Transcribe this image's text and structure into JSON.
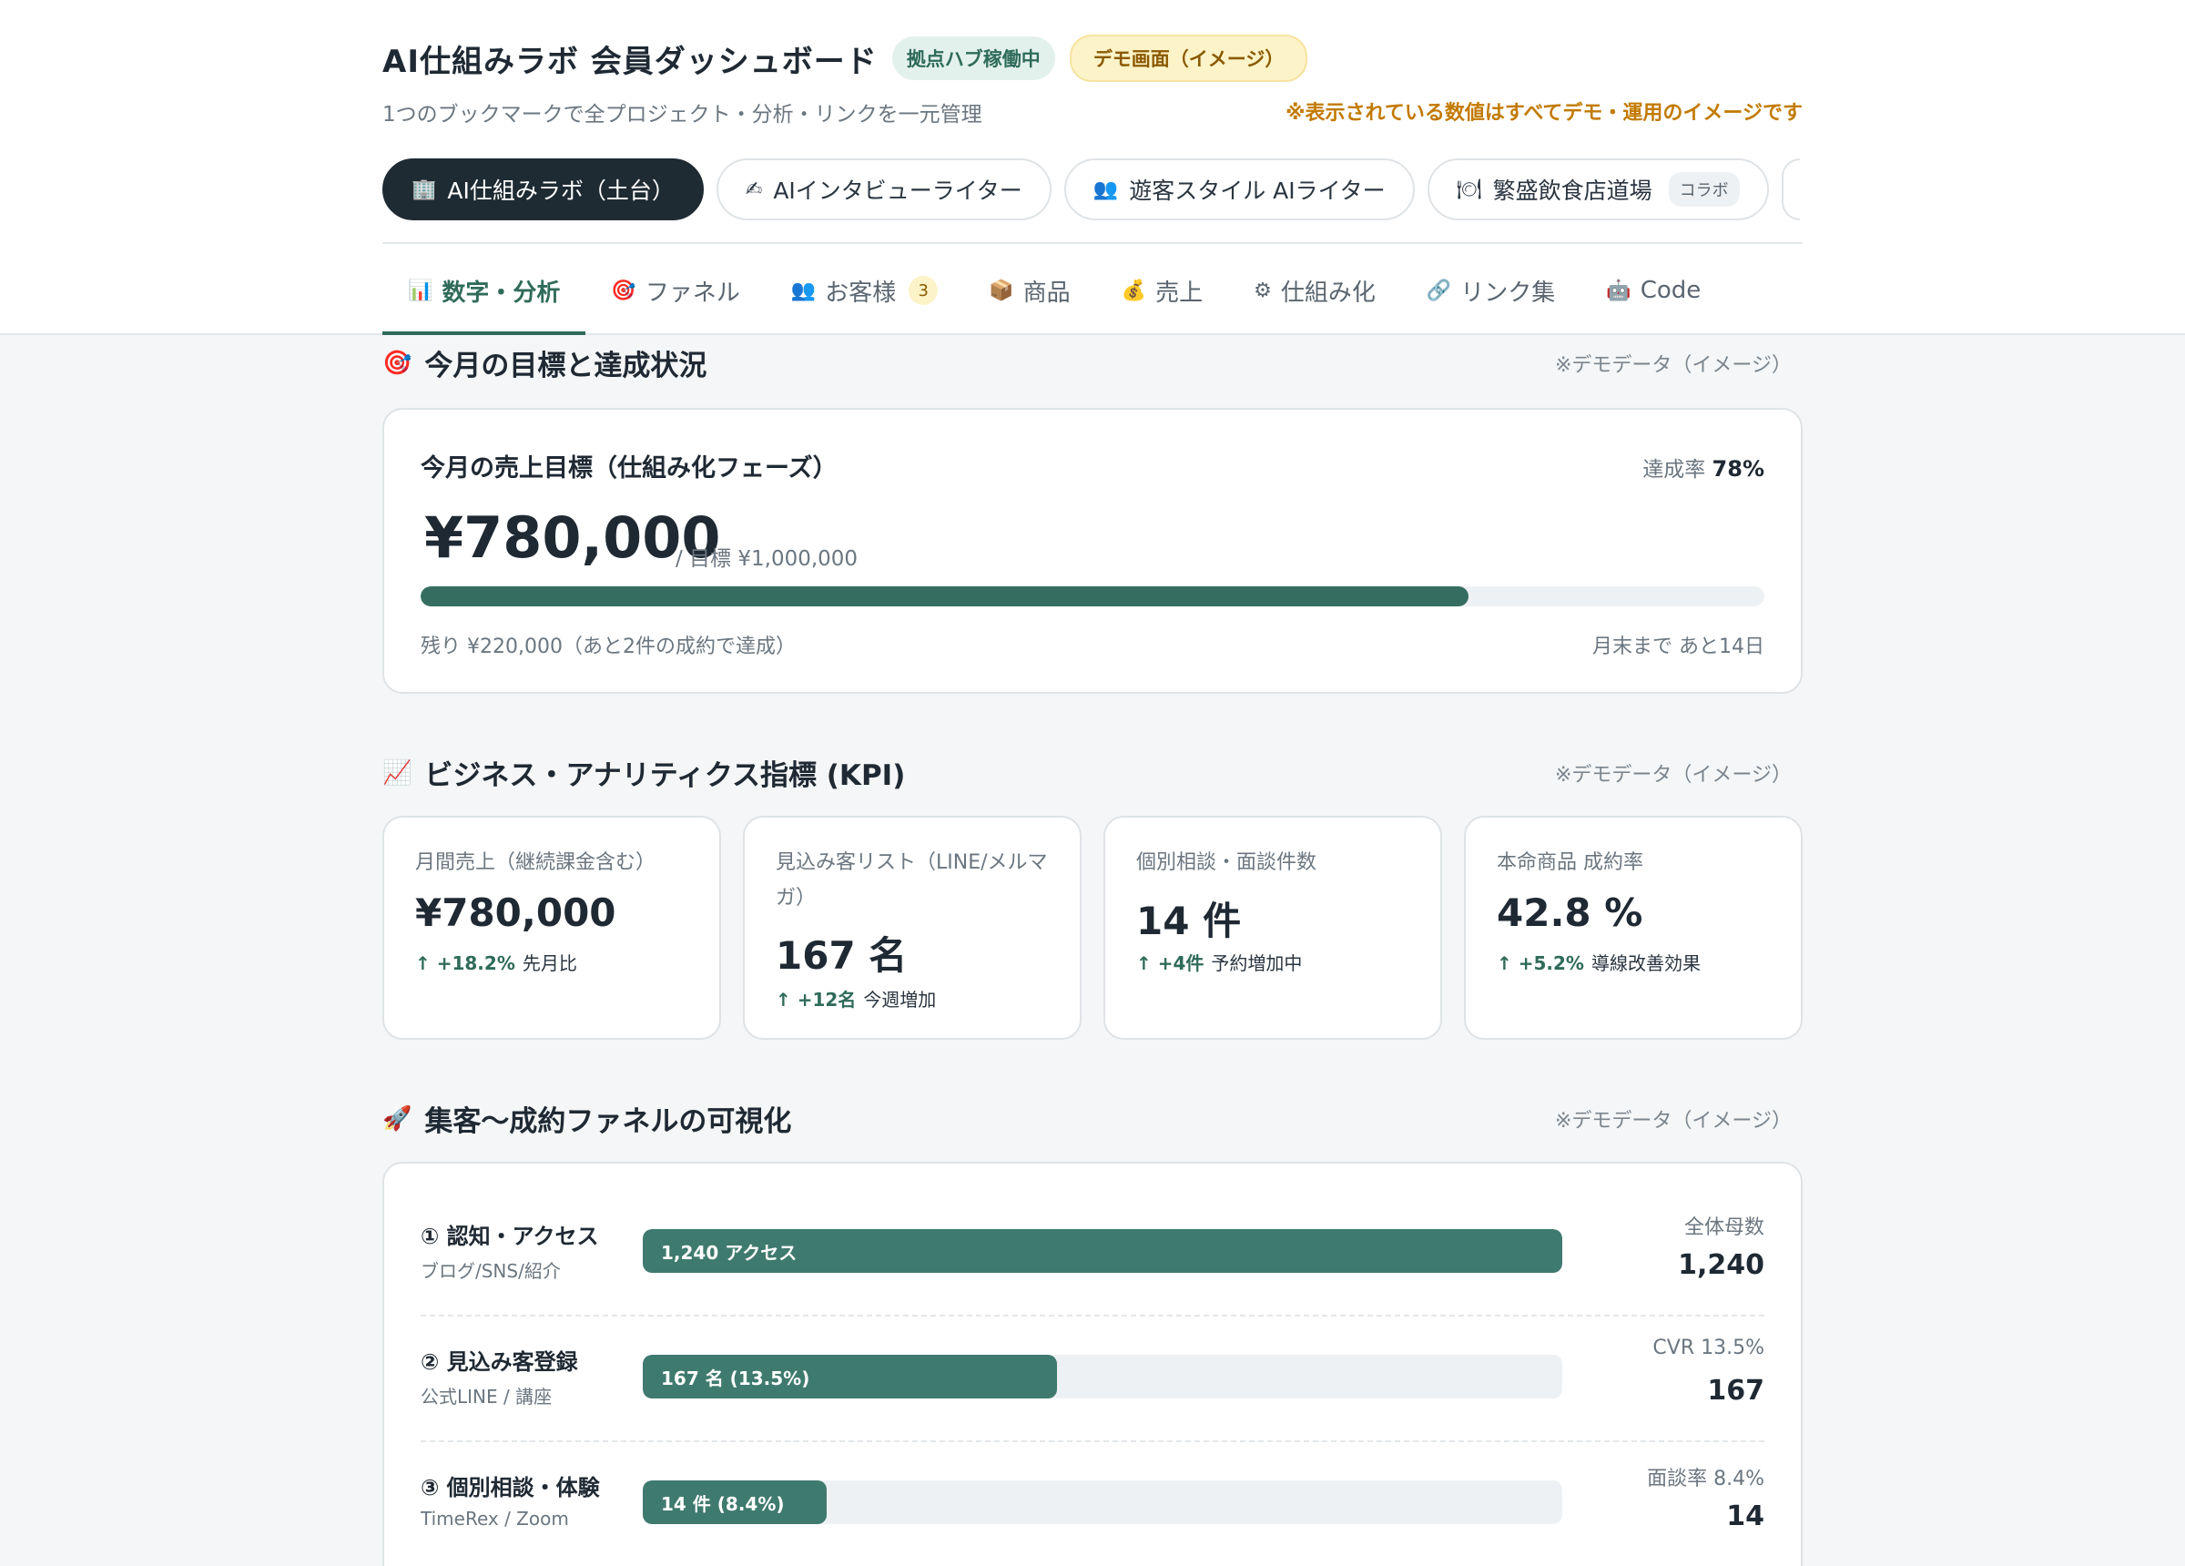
{
  "header": {
    "title": "AI仕組みラボ 会員ダッシュボード",
    "hub_badge": "拠点ハブ稼働中",
    "demo_badge": "デモ画面（イメージ）",
    "subtitle": "1つのブックマークで全プロジェクト・分析・リンクを一元管理",
    "demo_note": "※表示されている数値はすべてデモ・運用のイメージです"
  },
  "project_tabs": [
    {
      "label": "AI仕組みラボ（土台）",
      "icon": "🏢",
      "icon_name": "office-building-icon",
      "active": true
    },
    {
      "label": "AIインタビューライター",
      "icon": "✍",
      "icon_name": "writing-hand-icon",
      "active": false
    },
    {
      "label": "遊客スタイル AIライター",
      "icon": "👥",
      "icon_name": "people-icon",
      "active": false
    },
    {
      "label": "繁盛飲食店道場",
      "icon": "🍽",
      "icon_name": "plate-cutlery-icon",
      "badge": "コラボ",
      "active": false
    }
  ],
  "section_tabs": [
    {
      "label": "数字・分析",
      "icon": "📊",
      "icon_name": "bar-chart-icon",
      "active": true
    },
    {
      "label": "ファネル",
      "icon": "🎯",
      "icon_name": "target-icon"
    },
    {
      "label": "お客様",
      "icon": "👥",
      "icon_name": "people-icon",
      "count": "3"
    },
    {
      "label": "商品",
      "icon": "📦",
      "icon_name": "package-icon"
    },
    {
      "label": "売上",
      "icon": "💰",
      "icon_name": "money-bag-icon"
    },
    {
      "label": "仕組み化",
      "icon": "⚙",
      "icon_name": "gear-icon"
    },
    {
      "label": "リンク集",
      "icon": "🔗",
      "icon_name": "link-icon"
    },
    {
      "label": "Code",
      "icon": "🤖",
      "icon_name": "robot-icon"
    }
  ],
  "goal_section": {
    "title": "今月の目標と達成状況",
    "icon": "🎯",
    "note": "※デモデータ（イメージ）",
    "card_title": "今月の売上目標（仕組み化フェーズ）",
    "rate_label": "達成率",
    "rate_value": "78%",
    "progress": 0.78,
    "amount": "¥780,000",
    "target": "/ 目標 ¥1,000,000",
    "remaining": "残り ¥220,000（あと2件の成約で達成）",
    "days_left": "月末まで あと14日"
  },
  "kpi_section": {
    "title": "ビジネス・アナリティクス指標 (KPI)",
    "icon": "📈",
    "note": "※デモデータ（イメージ）",
    "cards": [
      {
        "label": "月間売上（継続課金含む）",
        "value": "¥780,000",
        "delta": "↑ +18.2%",
        "delta_text": "先月比"
      },
      {
        "label": "見込み客リスト（LINE/メルマガ）",
        "value": "167 名",
        "delta": "↑ +12名",
        "delta_text": "今週増加"
      },
      {
        "label": "個別相談・面談件数",
        "value": "14 件",
        "delta": "↑ +4件",
        "delta_text": "予約増加中"
      },
      {
        "label": "本命商品 成約率",
        "value": "42.8 %",
        "delta": "↑ +5.2%",
        "delta_text": "導線改善効果"
      }
    ]
  },
  "funnel_section": {
    "title": "集客〜成約ファネルの可視化",
    "icon": "🚀",
    "note": "※デモデータ（イメージ）",
    "rows": [
      {
        "name": "① 認知・アクセス",
        "sub": "ブログ/SNS/紹介",
        "bar_label": "1,240 アクセス",
        "fraction": 1.0,
        "right_label": "全体母数",
        "right_value": "1,240"
      },
      {
        "name": "② 見込み客登録",
        "sub": "公式LINE / 講座",
        "bar_label": "167 名 (13.5%)",
        "fraction": 0.45,
        "right_label": "CVR 13.5%",
        "right_value": "167"
      },
      {
        "name": "③ 個別相談・体験",
        "sub": "TimeRex / Zoom",
        "bar_label": "14 件 (8.4%)",
        "fraction": 0.2,
        "right_label": "面談率 8.4%",
        "right_value": "14"
      }
    ]
  }
}
